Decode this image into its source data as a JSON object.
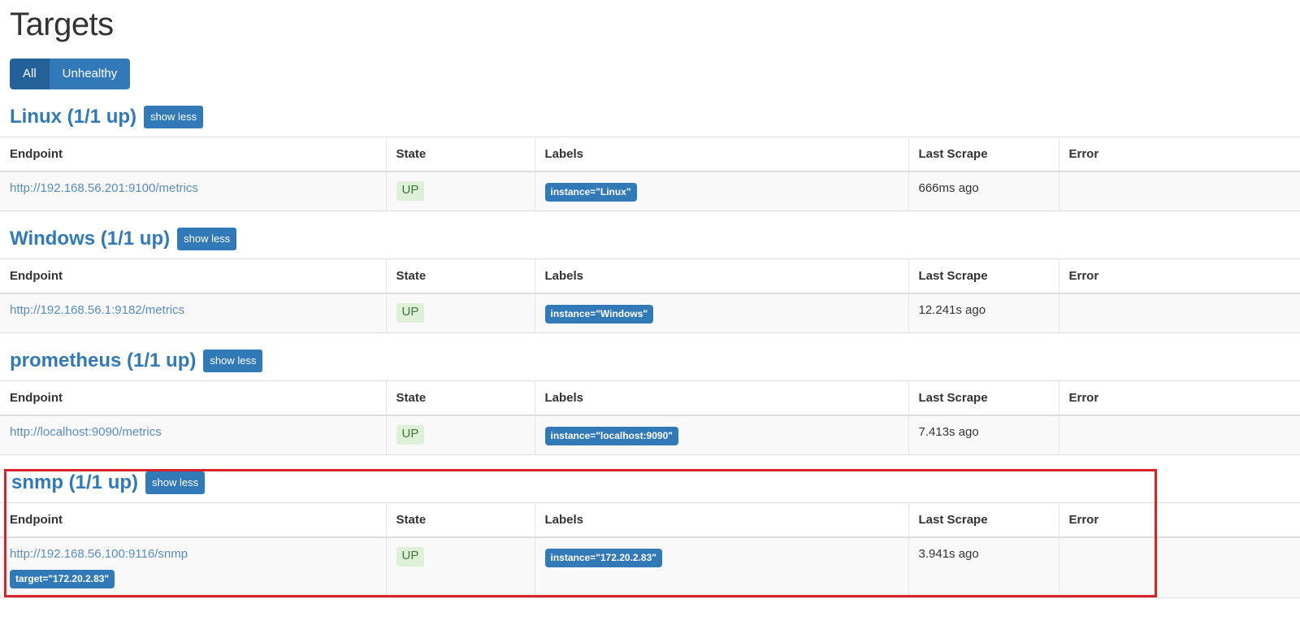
{
  "page": {
    "title": "Targets"
  },
  "filters": {
    "items": [
      {
        "label": "All",
        "active": true
      },
      {
        "label": "Unhealthy",
        "active": false
      }
    ]
  },
  "table": {
    "columns": [
      "Endpoint",
      "State",
      "Labels",
      "Last Scrape",
      "Error"
    ]
  },
  "show_less_label": "show less",
  "colors": {
    "accent_blue": "#3279b7",
    "accent_blue_active": "#256199",
    "link_blue": "#5b8cbe",
    "state_up_bg": "#dff0d8",
    "state_up_text": "#3c763d",
    "highlight_red": "#d8232a"
  },
  "jobs": [
    {
      "name": "Linux",
      "title": "Linux (1/1 up)",
      "highlighted": false,
      "targets": [
        {
          "endpoint": "http://192.168.56.201:9100/metrics",
          "endpoint_labels": [],
          "state": "UP",
          "labels": [
            "instance=\"Linux\""
          ],
          "last_scrape": "666ms ago",
          "error": ""
        }
      ]
    },
    {
      "name": "Windows",
      "title": "Windows (1/1 up)",
      "highlighted": false,
      "targets": [
        {
          "endpoint": "http://192.168.56.1:9182/metrics",
          "endpoint_labels": [],
          "state": "UP",
          "labels": [
            "instance=\"Windows\""
          ],
          "last_scrape": "12.241s ago",
          "error": ""
        }
      ]
    },
    {
      "name": "prometheus",
      "title": "prometheus (1/1 up)",
      "highlighted": false,
      "targets": [
        {
          "endpoint": "http://localhost:9090/metrics",
          "endpoint_labels": [],
          "state": "UP",
          "labels": [
            "instance=\"localhost:9090\""
          ],
          "last_scrape": "7.413s ago",
          "error": ""
        }
      ]
    },
    {
      "name": "snmp",
      "title": "snmp (1/1 up)",
      "highlighted": true,
      "targets": [
        {
          "endpoint": "http://192.168.56.100:9116/snmp",
          "endpoint_labels": [
            "target=\"172.20.2.83\""
          ],
          "state": "UP",
          "labels": [
            "instance=\"172.20.2.83\""
          ],
          "last_scrape": "3.941s ago",
          "error": ""
        }
      ]
    }
  ]
}
